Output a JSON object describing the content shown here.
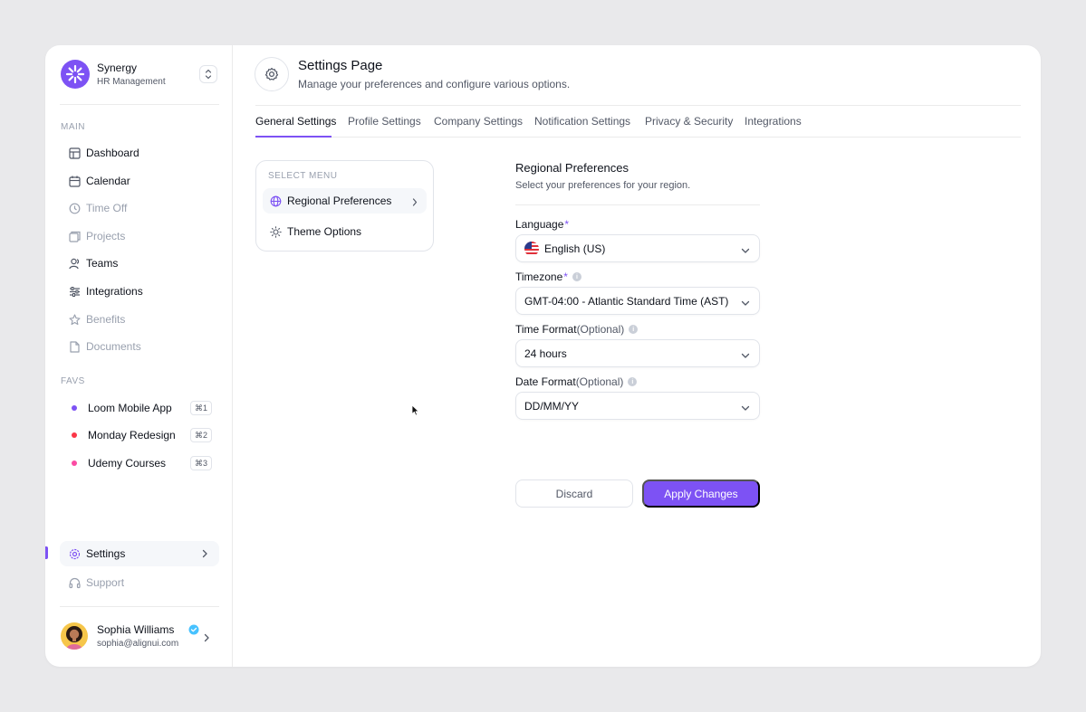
{
  "brand": {
    "name": "Synergy",
    "subtitle": "HR Management"
  },
  "sidebar": {
    "main_label": "MAIN",
    "main_items": [
      {
        "label": "Dashboard",
        "icon": "grid-icon",
        "dim": false
      },
      {
        "label": "Calendar",
        "icon": "calendar-icon",
        "dim": false
      },
      {
        "label": "Time Off",
        "icon": "clock-icon",
        "dim": true
      },
      {
        "label": "Projects",
        "icon": "folder-icon",
        "dim": true
      },
      {
        "label": "Teams",
        "icon": "users-icon",
        "dim": false
      },
      {
        "label": "Integrations",
        "icon": "sliders-icon",
        "dim": false
      },
      {
        "label": "Benefits",
        "icon": "star-icon",
        "dim": true
      },
      {
        "label": "Documents",
        "icon": "document-icon",
        "dim": true
      }
    ],
    "favs_label": "FAVS",
    "favs": [
      {
        "label": "Loom Mobile App",
        "shortcut": "⌘1",
        "color": "#7d52f4"
      },
      {
        "label": "Monday Redesign",
        "shortcut": "⌘2",
        "color": "#fb3748"
      },
      {
        "label": "Udemy Courses",
        "shortcut": "⌘3",
        "color": "#fb4ba3"
      }
    ],
    "settings_label": "Settings",
    "support_label": "Support"
  },
  "user": {
    "name": "Sophia Williams",
    "email": "sophia@alignui.com"
  },
  "header": {
    "title": "Settings Page",
    "subtitle": "Manage your preferences and configure various options."
  },
  "tabs": [
    "General Settings",
    "Profile Settings",
    "Company Settings",
    "Notification Settings",
    "Privacy & Security",
    "Integrations"
  ],
  "menu": {
    "label": "SELECT MENU",
    "items": [
      "Regional Preferences",
      "Theme Options"
    ]
  },
  "form": {
    "title": "Regional Preferences",
    "subtitle": "Select your preferences for your region.",
    "language": {
      "label": "Language",
      "required": "*",
      "value": "English (US)"
    },
    "timezone": {
      "label": "Timezone",
      "required": "*",
      "value": "GMT-04:00 - Atlantic Standard Time (AST)"
    },
    "time_format": {
      "label": "Time Format",
      "optional": "(Optional)",
      "value": "24 hours"
    },
    "date_format": {
      "label": "Date Format",
      "optional": "(Optional)",
      "value": "DD/MM/YY"
    },
    "discard_label": "Discard",
    "apply_label": "Apply Changes"
  },
  "colors": {
    "accent": "#7d52f4",
    "text": "#0e121b",
    "muted": "#525866",
    "soft": "#99a0ae"
  }
}
